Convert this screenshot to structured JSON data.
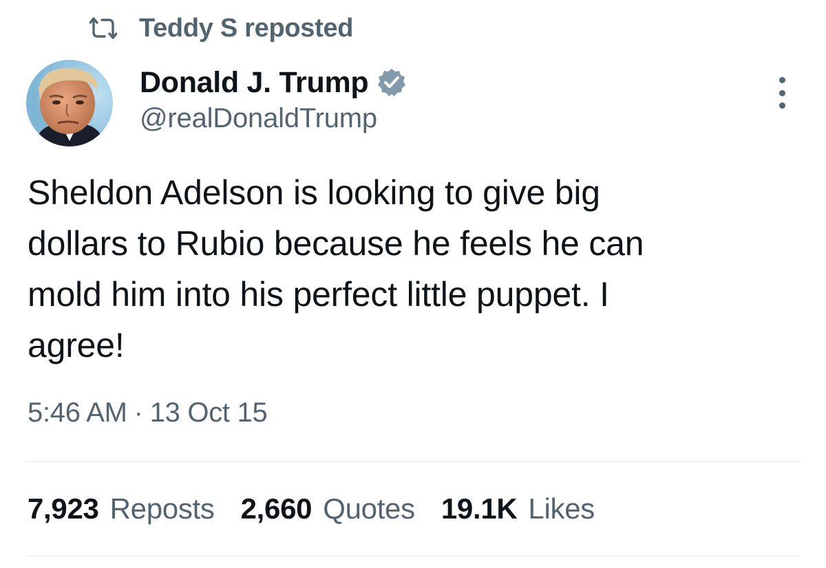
{
  "repost": {
    "icon": "repost-icon",
    "text": "Teddy S reposted"
  },
  "author": {
    "name": "Donald J. Trump",
    "handle": "@realDonaldTrump",
    "verified": true,
    "verified_icon": "verified-badge-icon",
    "avatar_icon": "avatar-photo"
  },
  "tweet": {
    "text": "Sheldon Adelson is looking to give big\ndollars to Rubio because he feels he can\nmold him into his perfect little puppet. I\nagree!",
    "time": "5:46 AM",
    "separator": "·",
    "date": "13 Oct 15"
  },
  "stats": [
    {
      "count": "7,923",
      "label": "Reposts"
    },
    {
      "count": "2,660",
      "label": "Quotes"
    },
    {
      "count": "19.1K",
      "label": "Likes"
    }
  ],
  "more_icon": "more-options-icon",
  "colors": {
    "text_primary": "#0f1419",
    "text_secondary": "#536471",
    "verified_badge": "#829aab",
    "divider": "#eff3f4"
  }
}
